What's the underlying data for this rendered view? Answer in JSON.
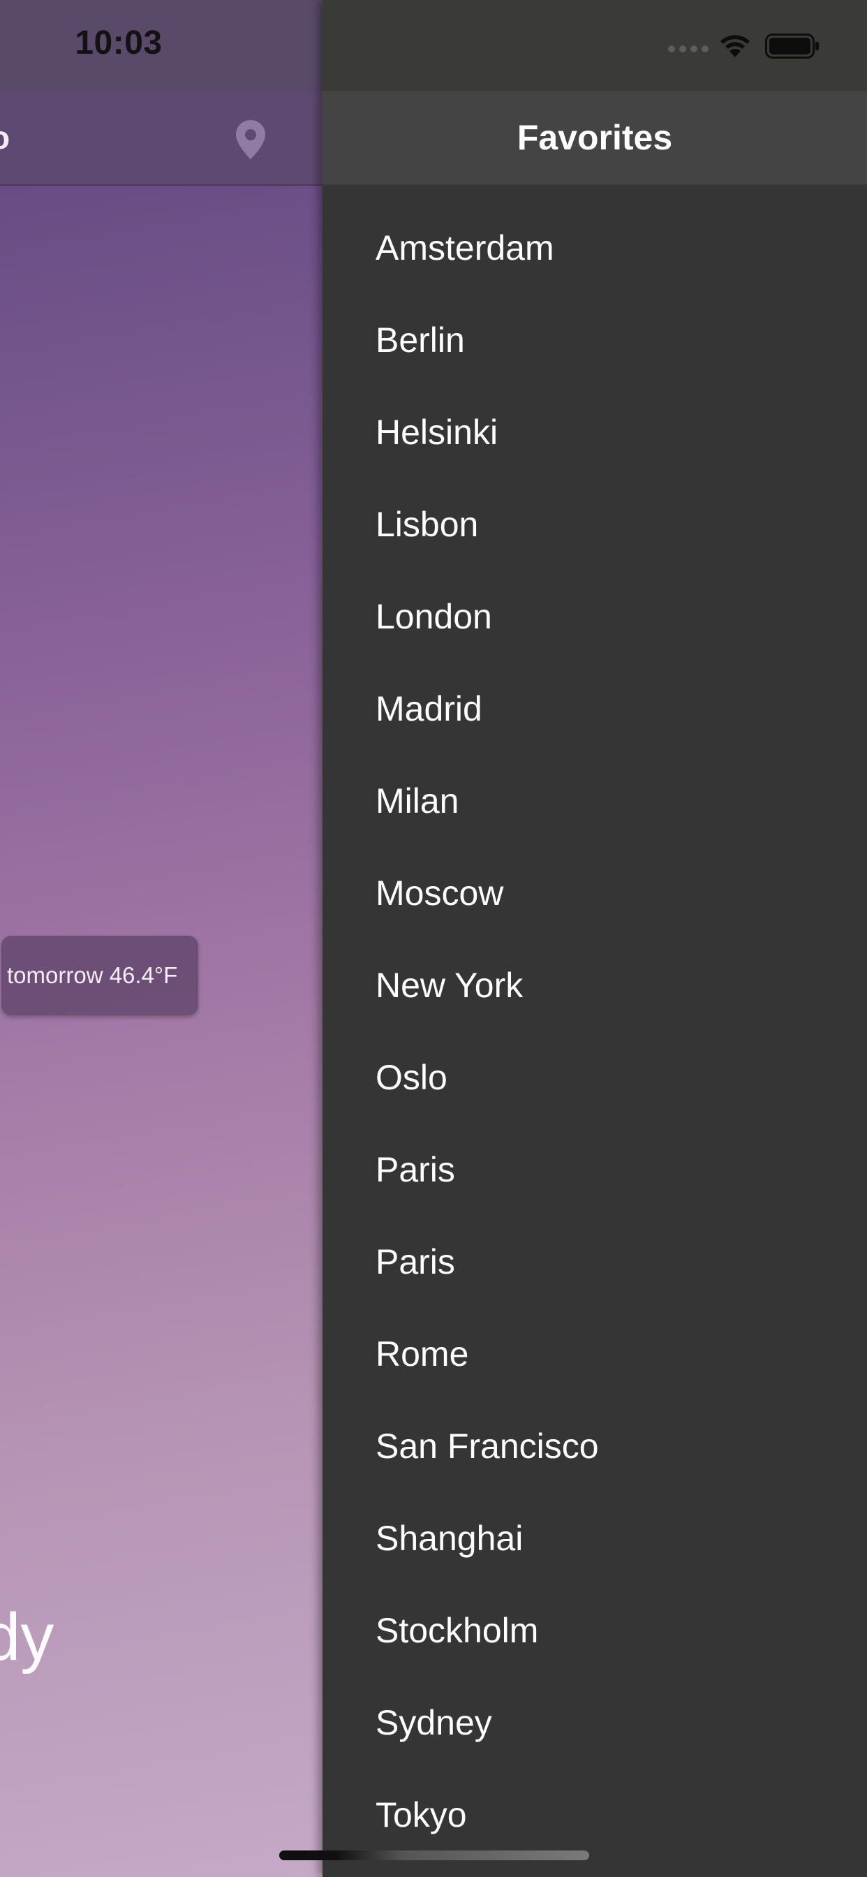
{
  "status_bar": {
    "time": "10:03"
  },
  "weather_screen": {
    "nav_title_fragment": "o",
    "forecast_chip": "tomorrow 46.4°F",
    "condition_fragment": "dy"
  },
  "favorites": {
    "title": "Favorites",
    "cities": [
      "Amsterdam",
      "Berlin",
      "Helsinki",
      "Lisbon",
      "London",
      "Madrid",
      "Milan",
      "Moscow",
      "New York",
      "Oslo",
      "Paris",
      "Paris",
      "Rome",
      "San Francisco",
      "Shanghai",
      "Stockholm",
      "Sydney",
      "Tokyo"
    ]
  },
  "icons": {
    "pin": "location-pin-icon",
    "signal": "cellular-signal-icon",
    "wifi": "wifi-icon",
    "battery": "battery-icon"
  },
  "colors": {
    "drawer_background": "#353535",
    "drawer_header": "#444444",
    "gradient_top": "#5c4476",
    "gradient_bottom": "#c5a9c6"
  }
}
